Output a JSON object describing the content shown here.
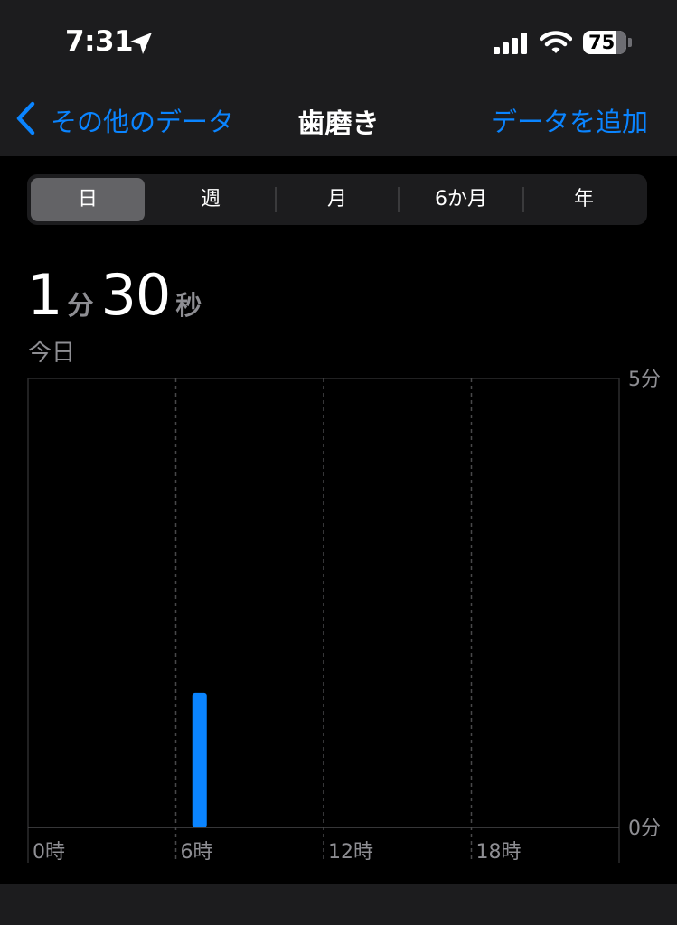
{
  "status_bar": {
    "time": "7:31",
    "battery": "75"
  },
  "nav": {
    "back_label": "その他のデータ",
    "title": "歯磨き",
    "add_label": "データを追加"
  },
  "segments": [
    {
      "label": "日",
      "selected": true
    },
    {
      "label": "週",
      "selected": false
    },
    {
      "label": "月",
      "selected": false
    },
    {
      "label": "6か月",
      "selected": false
    },
    {
      "label": "年",
      "selected": false
    }
  ],
  "summary": {
    "minutes": "1",
    "minutes_unit": "分",
    "seconds": "30",
    "seconds_unit": "秒",
    "date": "今日"
  },
  "colors": {
    "accent": "#0a84ff",
    "background": "#000000",
    "header": "#1c1c1e",
    "secondary_text": "#8e8e93"
  },
  "chart_data": {
    "type": "bar",
    "x_ticks": [
      "0時",
      "6時",
      "12時",
      "18時"
    ],
    "y_ticks": [
      "0分",
      "5分"
    ],
    "ylim": [
      0,
      5
    ],
    "xlim": [
      0,
      24
    ],
    "bars": [
      {
        "hour": 7,
        "value": 1.5
      }
    ],
    "bar_color": "#0a84ff",
    "grid": true
  }
}
